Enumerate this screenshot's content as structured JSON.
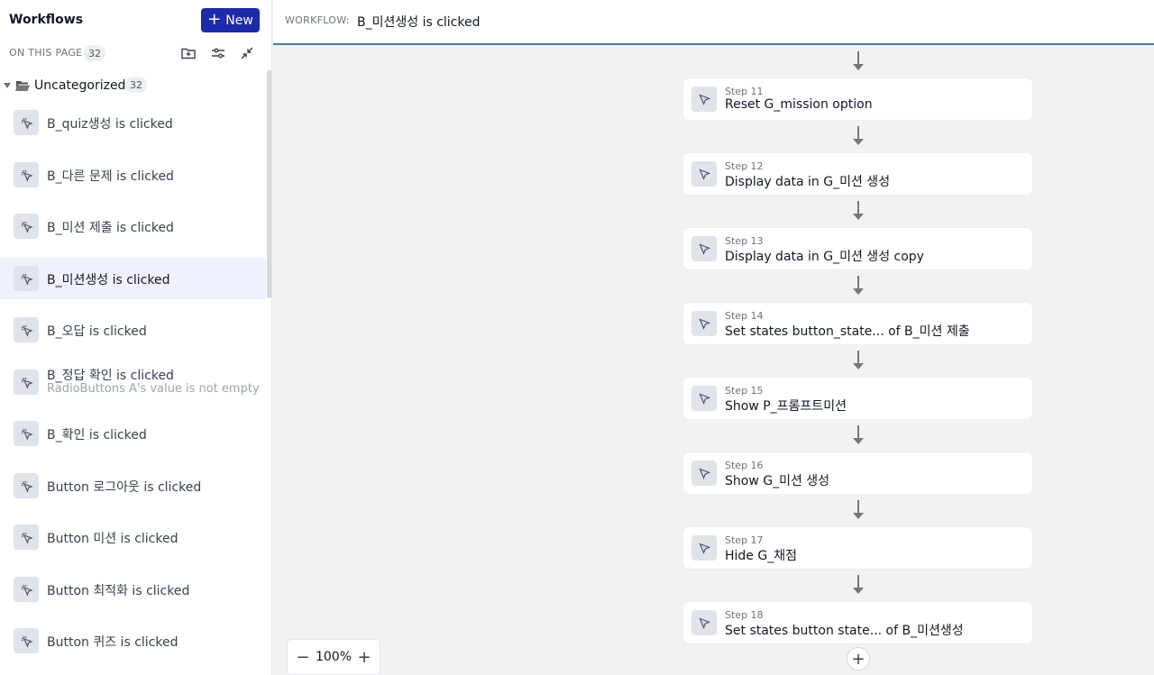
{
  "sidebar": {
    "title": "Workflows",
    "new_label": "New",
    "on_this_page_label": "ON THIS PAGE",
    "on_this_page_count": "32",
    "folder": {
      "label": "Uncategorized",
      "count": "32"
    },
    "items": [
      {
        "label": "B_quiz생성 is clicked"
      },
      {
        "label": "B_다른 문제 is clicked"
      },
      {
        "label": "B_미션 제출 is clicked"
      },
      {
        "label": "B_미션생성 is clicked",
        "selected": true
      },
      {
        "label": "B_오답  is clicked"
      },
      {
        "label": "B_정답 확인 is clicked",
        "sub": "RadioButtons A's value is not empty"
      },
      {
        "label": "B_확인 is clicked"
      },
      {
        "label": "Button 로그아웃 is clicked"
      },
      {
        "label": "Button 미션 is clicked"
      },
      {
        "label": "Button 최적화 is clicked"
      },
      {
        "label": "Button 퀴즈 is clicked"
      }
    ]
  },
  "header": {
    "workflow_key": "WORKFLOW:",
    "workflow_name": "B_미션생성 is clicked"
  },
  "steps": [
    {
      "number": "Step 11",
      "title": "Reset G_mission option"
    },
    {
      "number": "Step 12",
      "title": "Display data in G_미션 생성"
    },
    {
      "number": "Step 13",
      "title": "Display data in G_미션 생성 copy"
    },
    {
      "number": "Step 14",
      "title": "Set states button_state... of B_미션 제출"
    },
    {
      "number": "Step 15",
      "title": "Show P_프롬프트미션"
    },
    {
      "number": "Step 16",
      "title": "Show G_미션 생성"
    },
    {
      "number": "Step 17",
      "title": "Hide G_채점"
    },
    {
      "number": "Step 18",
      "title": "Set states button state... of B_미션생성"
    }
  ],
  "zoom": {
    "value": "100%",
    "minus": "−",
    "plus": "+"
  },
  "add_step_label": "+",
  "colors": {
    "accent": "#1f2aa8",
    "header_rule": "#4e7fa8",
    "selected_bg": "#eef2fd"
  }
}
